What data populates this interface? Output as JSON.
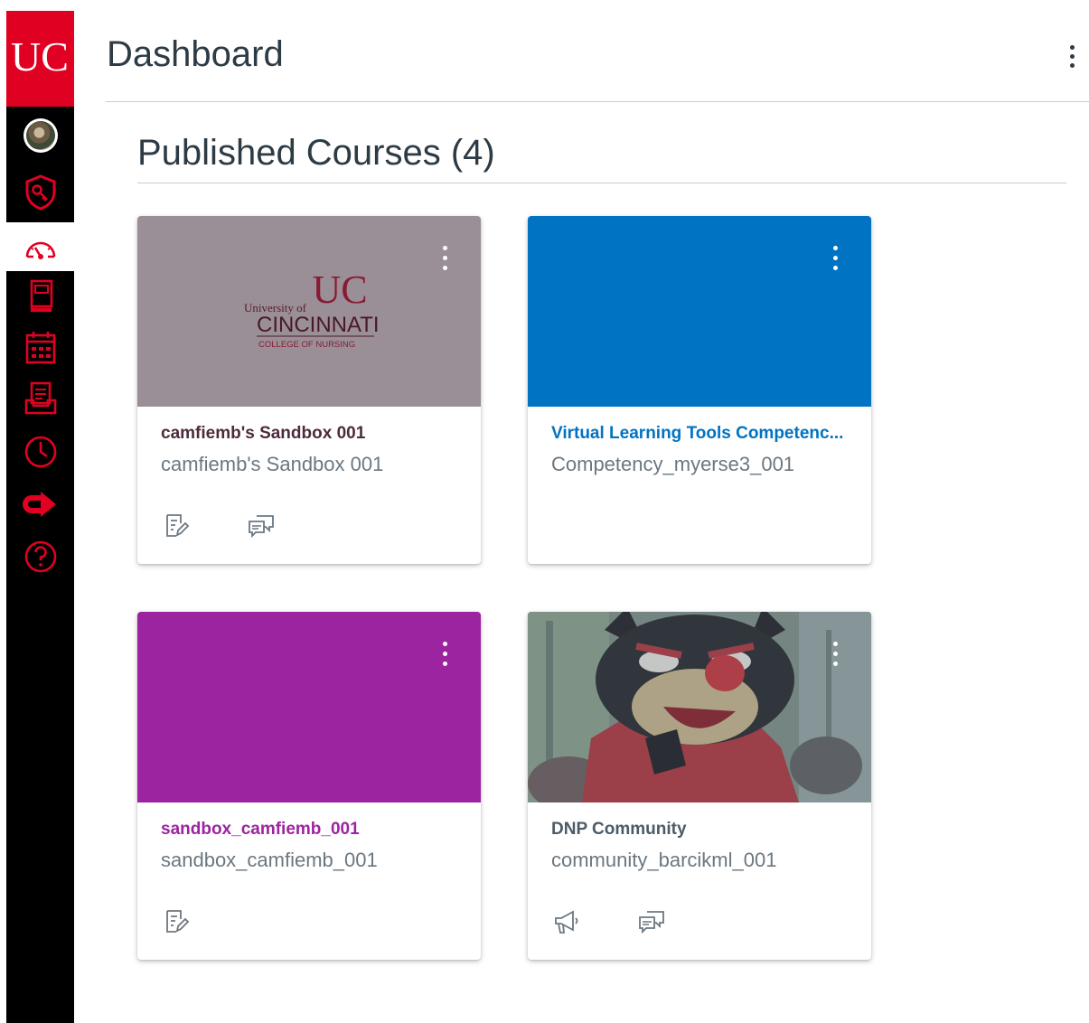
{
  "header": {
    "title": "Dashboard",
    "section_title": "Published Courses (4)"
  },
  "brand": {
    "nav_bg": "#000000",
    "accent_red": "#e00122",
    "logo_text": "UC"
  },
  "global_nav": {
    "items": [
      {
        "name": "account",
        "icon": "avatar"
      },
      {
        "name": "admin",
        "icon": "shield-key-icon"
      },
      {
        "name": "dashboard",
        "icon": "speedometer-icon",
        "active": true
      },
      {
        "name": "courses",
        "icon": "book-icon"
      },
      {
        "name": "calendar",
        "icon": "calendar-icon"
      },
      {
        "name": "inbox",
        "icon": "inbox-icon"
      },
      {
        "name": "history",
        "icon": "clock-icon"
      },
      {
        "name": "commons",
        "icon": "arrow-right-icon"
      },
      {
        "name": "help",
        "icon": "question-icon"
      }
    ]
  },
  "courses": [
    {
      "title": "camfiemb's Sandbox 001",
      "subtitle": "camfiemb's Sandbox 001",
      "color": "#9a8f96",
      "title_color": "#4d2b3c",
      "hero": "logo",
      "logo": {
        "line1": "University of",
        "line2": "CINCINNATI",
        "line3": "COLLEGE OF NURSING"
      },
      "actions": [
        "assignments-icon",
        "discussions-icon"
      ]
    },
    {
      "title": "Virtual Learning Tools Competenc...",
      "subtitle": "Competency_myerse3_001",
      "color": "#0073c3",
      "title_color": "#0073c3",
      "hero": "solid",
      "actions": []
    },
    {
      "title": "sandbox_camfiemb_001",
      "subtitle": "sandbox_camfiemb_001",
      "color": "#9c24a0",
      "title_color": "#9c24a0",
      "hero": "solid",
      "actions": [
        "assignments-icon"
      ]
    },
    {
      "title": "DNP Community",
      "subtitle": "community_barcikml_001",
      "color": "#5b6b78",
      "title_color": "#4d5b66",
      "hero": "photo",
      "actions": [
        "announcements-icon",
        "discussions-icon"
      ]
    }
  ]
}
